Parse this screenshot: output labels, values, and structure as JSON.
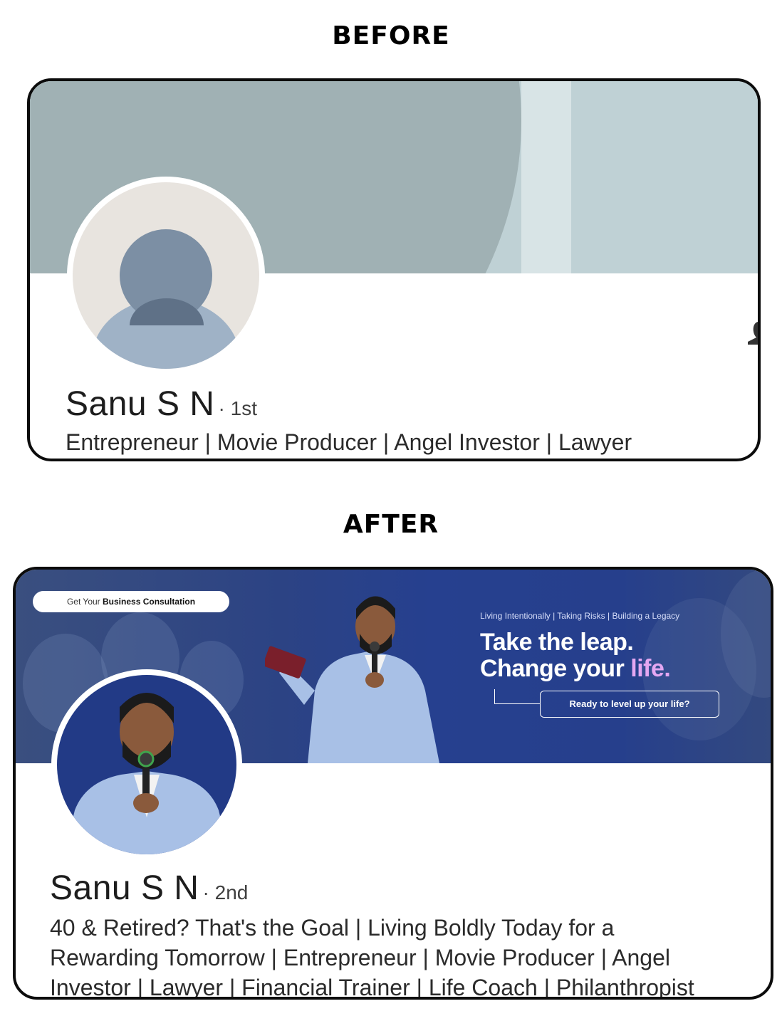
{
  "before": {
    "title": "BEFORE",
    "name": "Sanu S N",
    "degree": "· 1st",
    "headline": "Entrepreneur | Movie Producer | Angel Investor | Lawyer"
  },
  "after": {
    "title": "AFTER",
    "banner": {
      "pill_prefix": "Get Your",
      "pill_bold": "Business Consultation",
      "tagline": "Living Intentionally | Taking Risks | Building a Legacy",
      "line1": "Take the leap.",
      "line2_prefix": "Change your",
      "line2_accent": "life.",
      "cta": "Ready to level up your life?"
    },
    "name": "Sanu S N",
    "degree": "· 2nd",
    "headline_lines": [
      "40 & Retired? That's the Goal | Living Boldly Today for a",
      "Rewarding Tomorrow | Entrepreneur | Movie Producer | Angel",
      "Investor | Lawyer | Financial Trainer | Life Coach | Philanthropist"
    ]
  },
  "colors": {
    "before_banner": "#a0b1b4",
    "after_banner": "#263f8c",
    "accent_pink": "#e4a7f2",
    "suit_blue": "#a8c0e6"
  }
}
